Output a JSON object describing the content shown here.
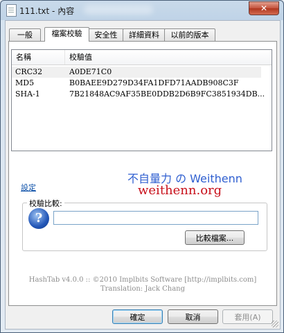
{
  "window": {
    "title": "111.txt - 內容",
    "close_label": "✕"
  },
  "tabs": [
    {
      "label": "一般"
    },
    {
      "label": "檔案校驗"
    },
    {
      "label": "安全性"
    },
    {
      "label": "詳細資料"
    },
    {
      "label": "以前的版本"
    }
  ],
  "hash_list": {
    "columns": [
      "名稱",
      "校驗值"
    ],
    "rows": [
      {
        "name": "CRC32",
        "value": "A0DE71C0"
      },
      {
        "name": "MD5",
        "value": "B0BAEE9D279D34FA1DFD71AADB908C3F"
      },
      {
        "name": "SHA-1",
        "value": "7B21848AC9AF35BE0DDB2D6B9FC3851934DB..."
      }
    ]
  },
  "watermark": {
    "line1": "不自量力 の Weithenn",
    "line2": "weithenn.org"
  },
  "settings_link": "設定",
  "compare": {
    "group_label": "校驗比較:",
    "input_value": "",
    "compare_file_button": "比較檔案..."
  },
  "footer": {
    "line1": "HashTab v4.0.0 :: ©2010 Implbits Software [http://implbits.com]",
    "line2": "Translation: Jack Chang"
  },
  "buttons": {
    "ok": "確定",
    "cancel": "取消",
    "apply": "套用(A)"
  },
  "colors": {
    "link": "#0b4fa8",
    "watermark_blue": "#2f5fd0",
    "watermark_red": "#c8101b"
  }
}
